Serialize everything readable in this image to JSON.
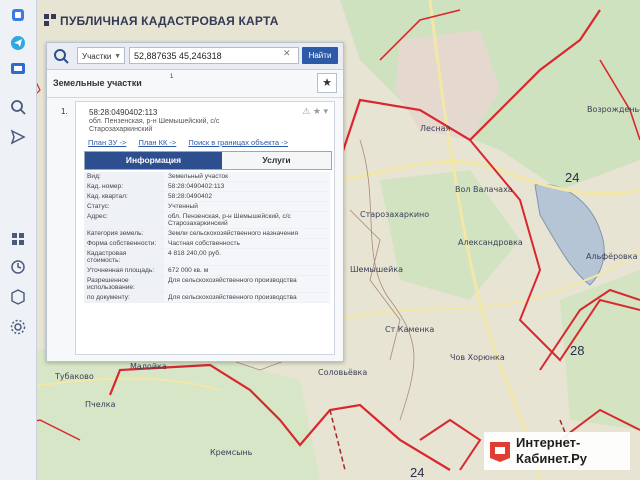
{
  "app": {
    "title": "ПУБЛИЧНАЯ КАДАСТРОВАЯ КАРТА"
  },
  "search": {
    "type_label": "Участки",
    "query": "52,887635 45,246318",
    "find_label": "Найти"
  },
  "section": {
    "title": "Земельные участки",
    "count": "1"
  },
  "result": {
    "index": "1.",
    "cadastral_number": "58:28:0490402:113",
    "address": "обл. Пензенская, р-н Шемышейский, с/с Старозахаркинский",
    "links": [
      "План ЗУ ->",
      "План КК ->",
      "Поиск в границах объекта ->"
    ],
    "tabs": [
      "Информация",
      "Услуги"
    ],
    "props": [
      {
        "key": "Вид:",
        "value": "Земельный участок"
      },
      {
        "key": "Кад. номер:",
        "value": "58:28:0490402:113"
      },
      {
        "key": "Кад. квартал:",
        "value": "58:28:0490402"
      },
      {
        "key": "Статус:",
        "value": "Учтенный"
      },
      {
        "key": "Адрес:",
        "value": "обл. Пензенская, р-н Шемышейский, с/с Старозахаркинский"
      },
      {
        "key": "Категория земель:",
        "value": "Земли сельскохозяйственного назначения"
      },
      {
        "key": "Форма собственности:",
        "value": "Частная собственность"
      },
      {
        "key": "Кадастровая стоимость:",
        "value": "4 818 240,00 руб."
      },
      {
        "key": "Уточненная площадь:",
        "value": "672 000 кв. м"
      },
      {
        "key": "Разрешенное использование:",
        "value": "Для сельскохозяйственного производства"
      },
      {
        "key": "по документу:",
        "value": "Для сельскохозяйственного производства"
      }
    ]
  },
  "map_labels": {
    "place_1": "Возрожденье",
    "place_2": "Лесная",
    "place_3": "Вол Валачаха",
    "place_4": "Александровка",
    "place_5": "Старозахаркино",
    "place_6": "Шемышейка",
    "place_7": "Соловьёвка",
    "place_8": "Альфёровка",
    "place_9": "Малойка",
    "place_10": "Ст Каменка",
    "place_11": "Чов Хорюнка",
    "place_12": "Тубаково",
    "place_13": "Пчелка",
    "place_14": "Кремсынь",
    "num_24a": "24",
    "num_24b": "24",
    "num_28": "28"
  },
  "watermark": {
    "line1": "Интернет-",
    "line2": "Кабинет.Ру"
  },
  "icons": {
    "left_bar": [
      "layers-icon",
      "telegram-icon",
      "messages-icon",
      "search-icon",
      "send-icon",
      "grid-icon",
      "clock-icon",
      "cube-icon",
      "settings-icon"
    ]
  },
  "colors": {
    "accent": "#2d5aa8",
    "boundary": "#d9272e",
    "tab_active": "#2d4e8f"
  }
}
